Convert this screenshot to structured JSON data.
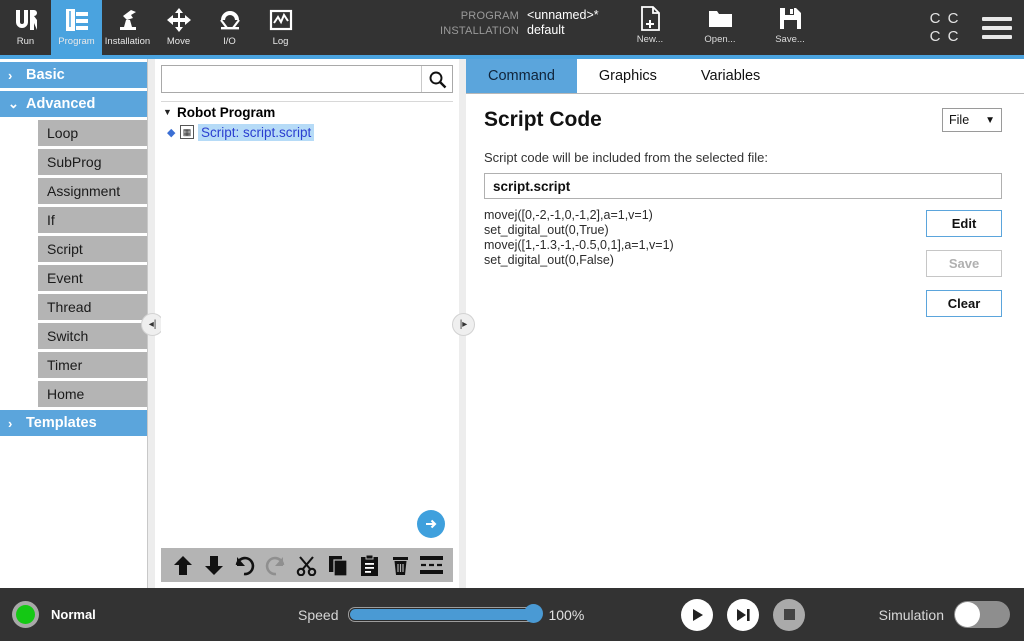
{
  "colors": {
    "accent_blue": "#5ba5dc",
    "topbar_dark": "#333333",
    "sidebar_item_grey": "#b4b4b4",
    "status_green": "#14c814",
    "selection_blue": "#b6dbf7"
  },
  "topbar": {
    "nav": [
      {
        "label": "Run",
        "icon": "ur-logo-icon",
        "active": false
      },
      {
        "label": "Program",
        "icon": "program-tree-icon",
        "active": true
      },
      {
        "label": "Installation",
        "icon": "robot-arm-icon",
        "active": false
      },
      {
        "label": "Move",
        "icon": "move-arrows-icon",
        "active": false
      },
      {
        "label": "I/O",
        "icon": "io-gauge-icon",
        "active": false
      },
      {
        "label": "Log",
        "icon": "log-graph-icon",
        "active": false
      }
    ],
    "program_key": "PROGRAM",
    "program_value": "<unnamed>*",
    "installation_key": "INSTALLATION",
    "installation_value": "default",
    "file_actions": [
      {
        "label": "New...",
        "icon": "new-file-icon"
      },
      {
        "label": "Open...",
        "icon": "open-folder-icon"
      },
      {
        "label": "Save...",
        "icon": "save-floppy-icon"
      }
    ],
    "c_grid": [
      "C",
      "C",
      "C",
      "C"
    ],
    "menu_icon": "hamburger-menu-icon"
  },
  "sidebar": {
    "categories": [
      {
        "label": "Basic",
        "expanded": false,
        "chevron": "›"
      },
      {
        "label": "Advanced",
        "expanded": true,
        "chevron": "⌄"
      },
      {
        "label": "Templates",
        "expanded": false,
        "chevron": "›"
      }
    ],
    "advanced_items": [
      "Loop",
      "SubProg",
      "Assignment",
      "If",
      "Script",
      "Event",
      "Thread",
      "Switch",
      "Timer",
      "Home"
    ]
  },
  "tree_panel": {
    "search": {
      "value": "",
      "placeholder": "",
      "icon": "search-icon"
    },
    "root_label": "Robot Program",
    "root_caret": "▼",
    "nodes": [
      {
        "label": "Script: script.script",
        "selected": true,
        "icon": "script-node-icon"
      }
    ],
    "forward_button_icon": "arrow-right-icon",
    "toolbar": [
      {
        "name": "move-up-button",
        "icon": "⬆",
        "disabled": false
      },
      {
        "name": "move-down-button",
        "icon": "⬇",
        "disabled": false
      },
      {
        "name": "undo-button",
        "icon": "↶",
        "disabled": false
      },
      {
        "name": "redo-button",
        "icon": "↷",
        "disabled": true
      },
      {
        "name": "cut-button",
        "icon": "✂",
        "disabled": false
      },
      {
        "name": "copy-button",
        "icon": "copy",
        "disabled": false
      },
      {
        "name": "paste-button",
        "icon": "paste",
        "disabled": false
      },
      {
        "name": "delete-button",
        "icon": "trash",
        "disabled": false
      },
      {
        "name": "suppress-button",
        "icon": "suppress",
        "disabled": false
      }
    ]
  },
  "main": {
    "tabs": [
      {
        "label": "Command",
        "active": true
      },
      {
        "label": "Graphics",
        "active": false
      },
      {
        "label": "Variables",
        "active": false
      }
    ],
    "title": "Script Code",
    "mode_select": {
      "value": "File",
      "caret": "▼"
    },
    "hint": "Script code will be included from the selected file:",
    "file_name": "script.script",
    "code_lines": [
      "movej([0,-2,-1,0,-1,2],a=1,v=1)",
      "set_digital_out(0,True)",
      "movej([1,-1.3,-1,-0.5,0,1],a=1,v=1)",
      "set_digital_out(0,False)"
    ],
    "buttons": [
      {
        "label": "Edit",
        "enabled": true
      },
      {
        "label": "Save",
        "enabled": false
      },
      {
        "label": "Clear",
        "enabled": true
      }
    ]
  },
  "bottombar": {
    "status_label": "Normal",
    "status_led": "green",
    "speed_label": "Speed",
    "speed_value": "100%",
    "speed_percent": 100,
    "transport": [
      {
        "name": "play-button",
        "icon": "play-icon",
        "enabled": true
      },
      {
        "name": "step-button",
        "icon": "step-icon",
        "enabled": true
      },
      {
        "name": "stop-button",
        "icon": "stop-icon",
        "enabled": false
      }
    ],
    "simulation_label": "Simulation",
    "simulation_on": false
  }
}
